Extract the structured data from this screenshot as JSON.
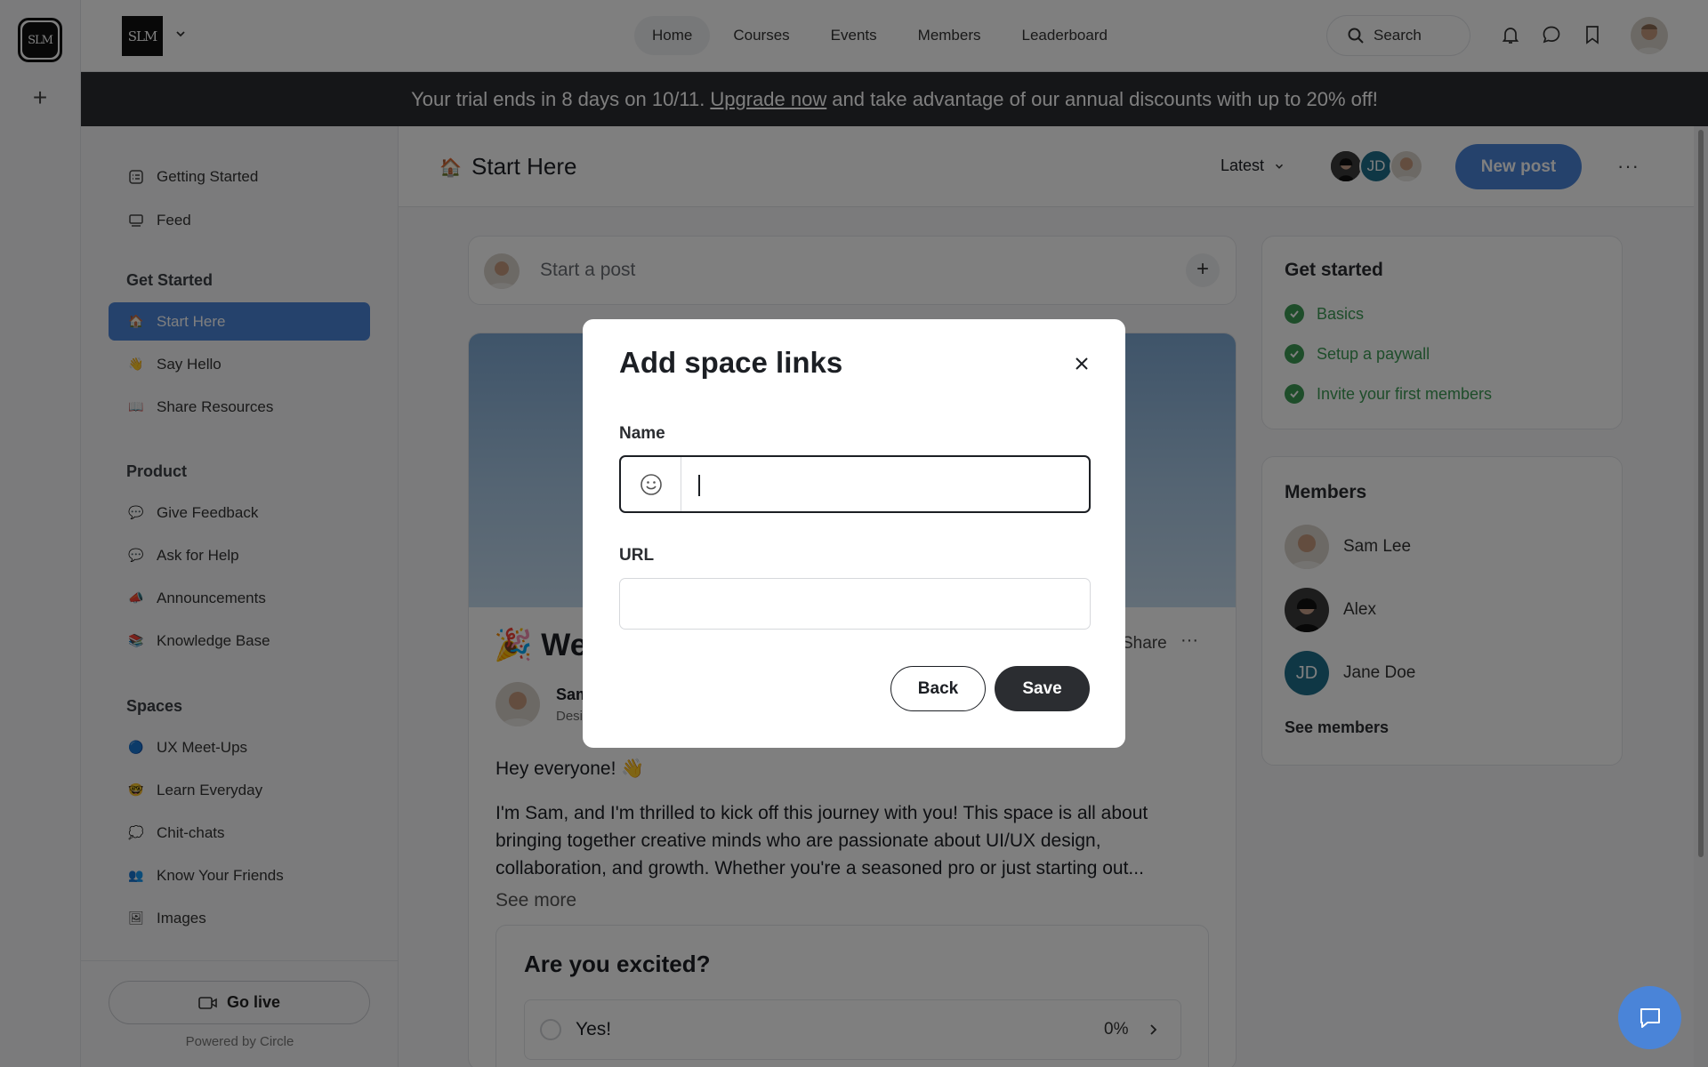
{
  "rail": {
    "logo_text": "SLM",
    "add_label": "+"
  },
  "header": {
    "brand_text": "SLM",
    "nav": [
      {
        "label": "Home",
        "active": true
      },
      {
        "label": "Courses"
      },
      {
        "label": "Events"
      },
      {
        "label": "Members"
      },
      {
        "label": "Leaderboard"
      }
    ],
    "search_label": "Search"
  },
  "banner": {
    "prefix": "Your trial ends in 8 days on 10/11.",
    "link": "Upgrade now",
    "suffix": "and take advantage of our annual discounts with up to 20% off!"
  },
  "sidebar": {
    "top_items": [
      {
        "label": "Getting Started",
        "icon": "checklist-icon"
      },
      {
        "label": "Feed",
        "icon": "feed-icon"
      }
    ],
    "sections": [
      {
        "title": "Get Started",
        "items": [
          {
            "label": "Start Here",
            "emoji": "🏠",
            "active": true
          },
          {
            "label": "Say Hello",
            "emoji": "👋"
          },
          {
            "label": "Share Resources",
            "emoji": "📖"
          }
        ]
      },
      {
        "title": "Product",
        "items": [
          {
            "label": "Give Feedback",
            "emoji": "💬"
          },
          {
            "label": "Ask for Help",
            "emoji": "💬"
          },
          {
            "label": "Announcements",
            "emoji": "📣"
          },
          {
            "label": "Knowledge Base",
            "emoji": "📚"
          }
        ]
      },
      {
        "title": "Spaces",
        "items": [
          {
            "label": "UX Meet-Ups",
            "emoji": "🔵"
          },
          {
            "label": "Learn Everyday",
            "emoji": "🤓"
          },
          {
            "label": "Chit-chats",
            "emoji": "💭"
          },
          {
            "label": "Know Your Friends",
            "emoji": "👥"
          },
          {
            "label": "Images",
            "emoji": "🖼"
          }
        ]
      }
    ],
    "go_live": "Go live",
    "powered_by": "Powered by Circle"
  },
  "main": {
    "title": "Start Here",
    "title_emoji": "🏠",
    "sort_label": "Latest",
    "stack_initials": "JD",
    "new_post": "New post",
    "more": "···",
    "composer_placeholder": "Start a post",
    "post": {
      "title": "🎉 Welc",
      "share": "Share",
      "more": "···",
      "author_name": "Sam",
      "author_role": "Desi",
      "greeting": "Hey everyone! 👋",
      "body": "I'm Sam, and I'm thrilled to kick off this journey with you! This space is all about bringing together creative minds who are passionate about UI/UX design, collaboration, and growth. Whether you're a seasoned pro or just starting out...",
      "see_more": "See more",
      "poll_title": "Are you excited?",
      "poll_option": "Yes!",
      "poll_pct": "0%"
    }
  },
  "right": {
    "get_started_title": "Get started",
    "steps": [
      "Basics",
      "Setup a paywall",
      "Invite your first members"
    ],
    "members_title": "Members",
    "members": [
      {
        "name": "Sam Lee"
      },
      {
        "name": "Alex"
      },
      {
        "name": "Jane Doe",
        "initials": "JD"
      }
    ],
    "see_members": "See members"
  },
  "modal": {
    "title": "Add space links",
    "name_label": "Name",
    "url_label": "URL",
    "name_value": "",
    "url_value": "",
    "back": "Back",
    "save": "Save"
  },
  "colors": {
    "accent": "#4a84d8",
    "dark": "#2b2d31",
    "success": "#3c9a55",
    "jd_avatar": "#1f6f8b"
  }
}
